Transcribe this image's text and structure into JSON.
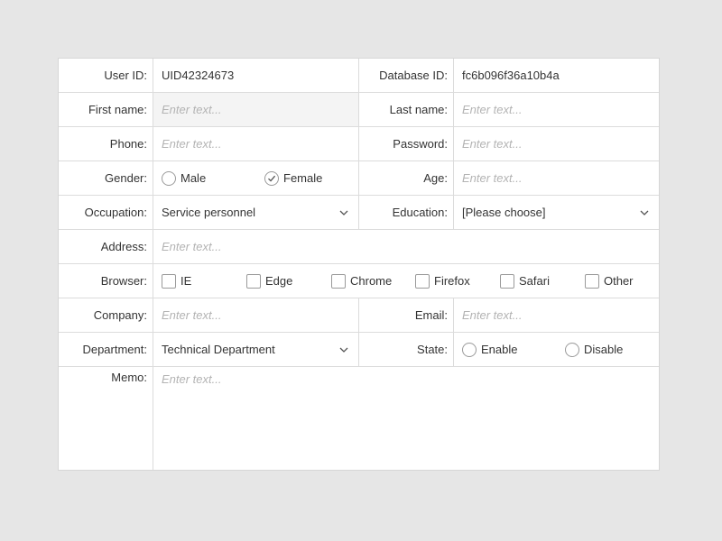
{
  "colors": {
    "background": "#e6e6e6",
    "border": "#dcdcdc",
    "placeholder": "#b3b3b3",
    "readonly_fill": "#f4f4f4"
  },
  "user_id": {
    "label": "User ID:",
    "value": "UID42324673"
  },
  "database_id": {
    "label": "Database ID:",
    "value": "fc6b096f36a10b4a"
  },
  "first_name": {
    "label": "First name:",
    "placeholder": "Enter text..."
  },
  "last_name": {
    "label": "Last name:",
    "placeholder": "Enter text..."
  },
  "phone": {
    "label": "Phone:",
    "placeholder": "Enter text..."
  },
  "password": {
    "label": "Password:",
    "placeholder": "Enter text..."
  },
  "gender": {
    "label": "Gender:",
    "options": [
      "Male",
      "Female"
    ],
    "selected": "Female"
  },
  "age": {
    "label": "Age:",
    "placeholder": "Enter text..."
  },
  "occupation": {
    "label": "Occupation:",
    "value": "Service personnel",
    "icon": "chevron-down-icon"
  },
  "education": {
    "label": "Education:",
    "value": "[Please choose]",
    "icon": "chevron-down-icon"
  },
  "address": {
    "label": "Address:",
    "placeholder": "Enter text..."
  },
  "browser": {
    "label": "Browser:",
    "options": [
      "IE",
      "Edge",
      "Chrome",
      "Firefox",
      "Safari",
      "Other"
    ],
    "checked": []
  },
  "company": {
    "label": "Company:",
    "placeholder": "Enter text..."
  },
  "email": {
    "label": "Email:",
    "placeholder": "Enter text..."
  },
  "department": {
    "label": "Department:",
    "value": "Technical Department",
    "icon": "chevron-down-icon"
  },
  "state": {
    "label": "State:",
    "options": [
      "Enable",
      "Disable"
    ],
    "selected": ""
  },
  "memo": {
    "label": "Memo:",
    "placeholder": "Enter text..."
  }
}
